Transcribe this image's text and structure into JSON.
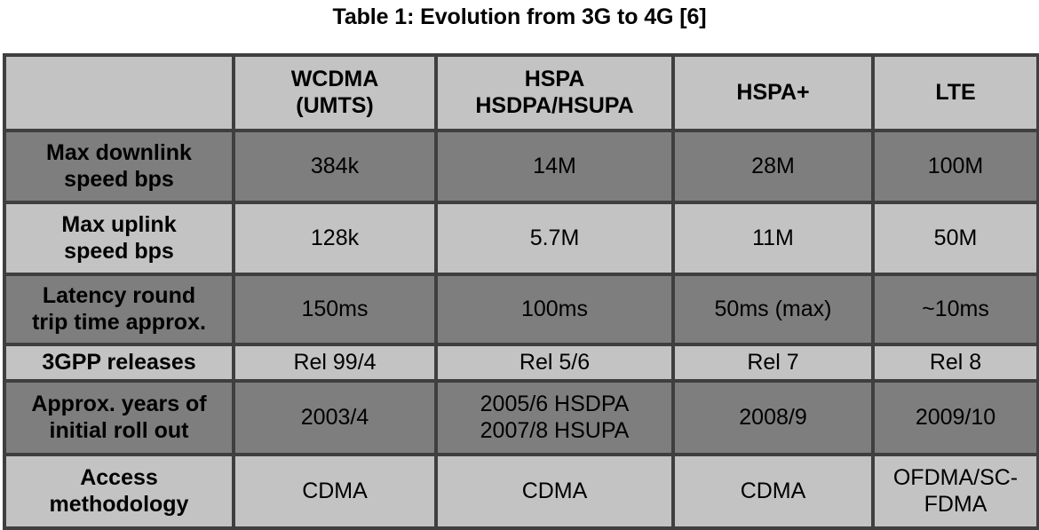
{
  "caption": "Table 1: Evolution from 3G to 4G [6]",
  "colors": {
    "row_dark": "#7e7e7e",
    "row_light": "#c3c3c3",
    "border": "#3f3f3f",
    "text": "#000000",
    "page_background": "#ffffff"
  },
  "table": {
    "headers": [
      "",
      "WCDMA\n(UMTS)",
      "HSPA\nHSDPA/HSUPA",
      "HSPA+",
      "LTE"
    ],
    "rows": [
      {
        "shade": "dark",
        "label": "Max downlink\nspeed bps",
        "values": [
          "384k",
          "14M",
          "28M",
          "100M"
        ]
      },
      {
        "shade": "light",
        "label": "Max uplink\nspeed bps",
        "values": [
          "128k",
          "5.7M",
          "11M",
          "50M"
        ]
      },
      {
        "shade": "dark",
        "label": "Latency round\ntrip time approx.",
        "values": [
          "150ms",
          "100ms",
          "50ms (max)",
          "~10ms"
        ]
      },
      {
        "shade": "light",
        "label": "3GPP releases",
        "values": [
          "Rel 99/4",
          "Rel 5/6",
          "Rel 7",
          "Rel 8"
        ]
      },
      {
        "shade": "dark",
        "label": "Approx. years of\ninitial roll out",
        "values": [
          "2003/4",
          "2005/6 HSDPA\n2007/8 HSUPA",
          "2008/9",
          "2009/10"
        ]
      },
      {
        "shade": "light",
        "label": "Access\nmethodology",
        "values": [
          "CDMA",
          "CDMA",
          "CDMA",
          "OFDMA/SC-\nFDMA"
        ]
      }
    ]
  }
}
